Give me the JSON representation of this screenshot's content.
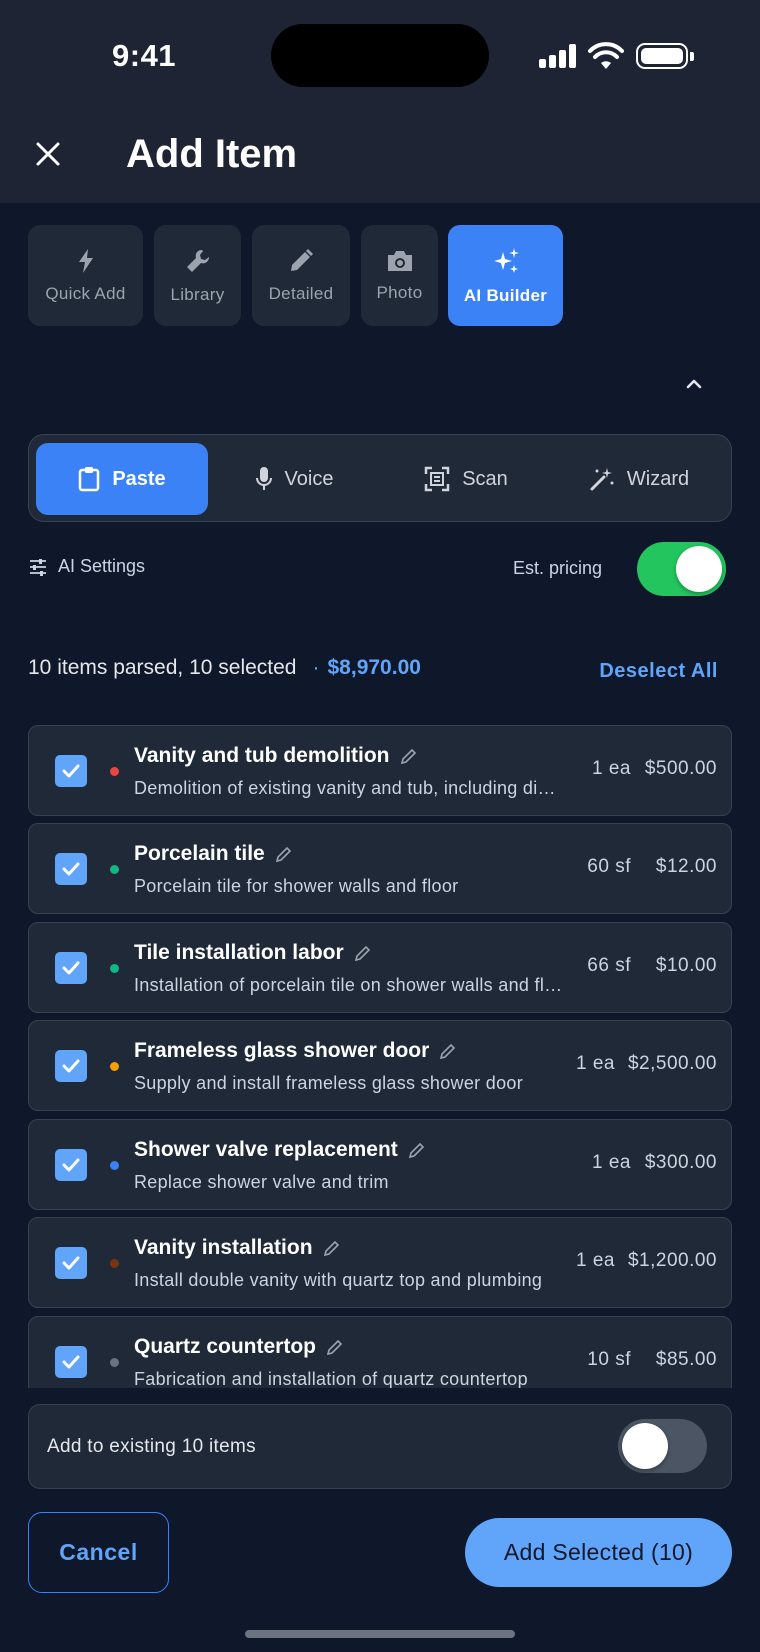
{
  "status": {
    "time": "9:41"
  },
  "header": {
    "title": "Add Item"
  },
  "mode_tabs": [
    {
      "label": "Quick Add",
      "icon": "bolt-icon",
      "active": false
    },
    {
      "label": "Library",
      "icon": "wrench-icon",
      "active": false
    },
    {
      "label": "Detailed",
      "icon": "pencil-icon",
      "active": false
    },
    {
      "label": "Photo",
      "icon": "camera-icon",
      "active": false
    },
    {
      "label": "AI Builder",
      "icon": "sparkles-icon",
      "active": true
    }
  ],
  "input_modes": [
    {
      "label": "Paste",
      "icon": "clipboard-icon",
      "active": true
    },
    {
      "label": "Voice",
      "icon": "microphone-icon",
      "active": false
    },
    {
      "label": "Scan",
      "icon": "scan-icon",
      "active": false
    },
    {
      "label": "Wizard",
      "icon": "magic-wand-icon",
      "active": false
    }
  ],
  "settings": {
    "ai_settings_label": "AI Settings",
    "est_pricing_label": "Est. pricing",
    "est_pricing_on": true
  },
  "summary": {
    "text": "10 items parsed, 10 selected",
    "separator": "·",
    "total": "$8,970.00",
    "deselect_label": "Deselect All"
  },
  "items": [
    {
      "name": "Vanity and tub demolition",
      "desc": "Demolition of existing vanity and tub, including disposal",
      "qty": "1 ea",
      "price": "$500.00",
      "dot_color": "#ef4444",
      "checked": true
    },
    {
      "name": "Porcelain tile",
      "desc": "Porcelain tile for shower walls and floor",
      "qty": "60 sf",
      "price": "$12.00",
      "dot_color": "#10b981",
      "checked": true
    },
    {
      "name": "Tile installation labor",
      "desc": "Installation of porcelain tile on shower walls and floor",
      "qty": "66 sf",
      "price": "$10.00",
      "dot_color": "#10b981",
      "checked": true
    },
    {
      "name": "Frameless glass shower door",
      "desc": "Supply and install frameless glass shower door",
      "qty": "1 ea",
      "price": "$2,500.00",
      "dot_color": "#f59e0b",
      "checked": true
    },
    {
      "name": "Shower valve replacement",
      "desc": "Replace shower valve and trim",
      "qty": "1 ea",
      "price": "$300.00",
      "dot_color": "#3b82f6",
      "checked": true
    },
    {
      "name": "Vanity installation",
      "desc": "Install double vanity with quartz top and plumbing",
      "qty": "1 ea",
      "price": "$1,200.00",
      "dot_color": "#78350f",
      "checked": true
    },
    {
      "name": "Quartz countertop",
      "desc": "Fabrication and installation of quartz countertop",
      "qty": "10 sf",
      "price": "$85.00",
      "dot_color": "#6b7280",
      "checked": true
    }
  ],
  "add_existing": {
    "label": "Add to existing 10 items",
    "on": false
  },
  "footer": {
    "cancel_label": "Cancel",
    "add_label": "Add Selected (10)"
  }
}
